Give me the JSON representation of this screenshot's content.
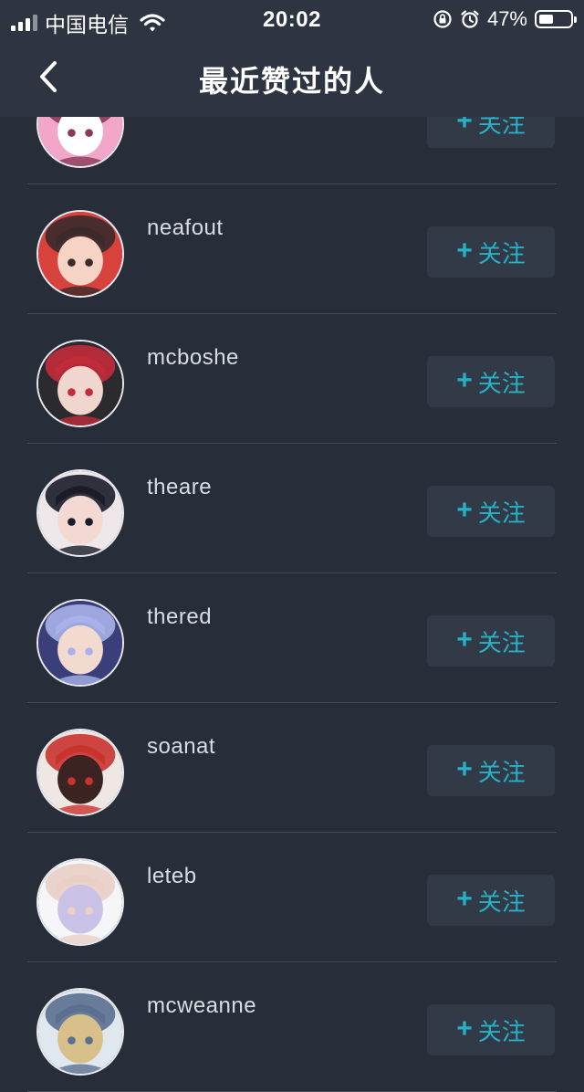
{
  "status_bar": {
    "carrier": "中国电信",
    "time": "20:02",
    "battery": "47%",
    "battery_level": 0.47
  },
  "nav": {
    "title": "最近赞过的人",
    "back_icon": "chevron-left-icon"
  },
  "follow_label": "关注",
  "follow_plus": "+",
  "users": [
    {
      "name": "",
      "avatar_colors": [
        "#f2a6c8",
        "#ffffff",
        "#8a3a58"
      ]
    },
    {
      "name": "neafout",
      "avatar_colors": [
        "#d8423c",
        "#f6d3c4",
        "#3a2a2a"
      ]
    },
    {
      "name": "mcboshe",
      "avatar_colors": [
        "#2b2a2e",
        "#f1d6cf",
        "#c22b3a"
      ]
    },
    {
      "name": "theare",
      "avatar_colors": [
        "#efe8ea",
        "#f4d8d2",
        "#1a1c28"
      ]
    },
    {
      "name": "thered",
      "avatar_colors": [
        "#3a3f7a",
        "#f3dad0",
        "#a8b2e8"
      ]
    },
    {
      "name": "soanat",
      "avatar_colors": [
        "#efe7e3",
        "#3a2320",
        "#c8332f"
      ]
    },
    {
      "name": "leteb",
      "avatar_colors": [
        "#f6f6f8",
        "#c9c2e6",
        "#e9cfc4"
      ]
    },
    {
      "name": "mcweanne",
      "avatar_colors": [
        "#dfe8ef",
        "#d8c08a",
        "#5b6f8f"
      ]
    }
  ],
  "colors": {
    "background": "#282d3a",
    "header": "#2e3441",
    "accent": "#27b1c6",
    "button_bg": "#323947",
    "divider": "#454b57"
  }
}
